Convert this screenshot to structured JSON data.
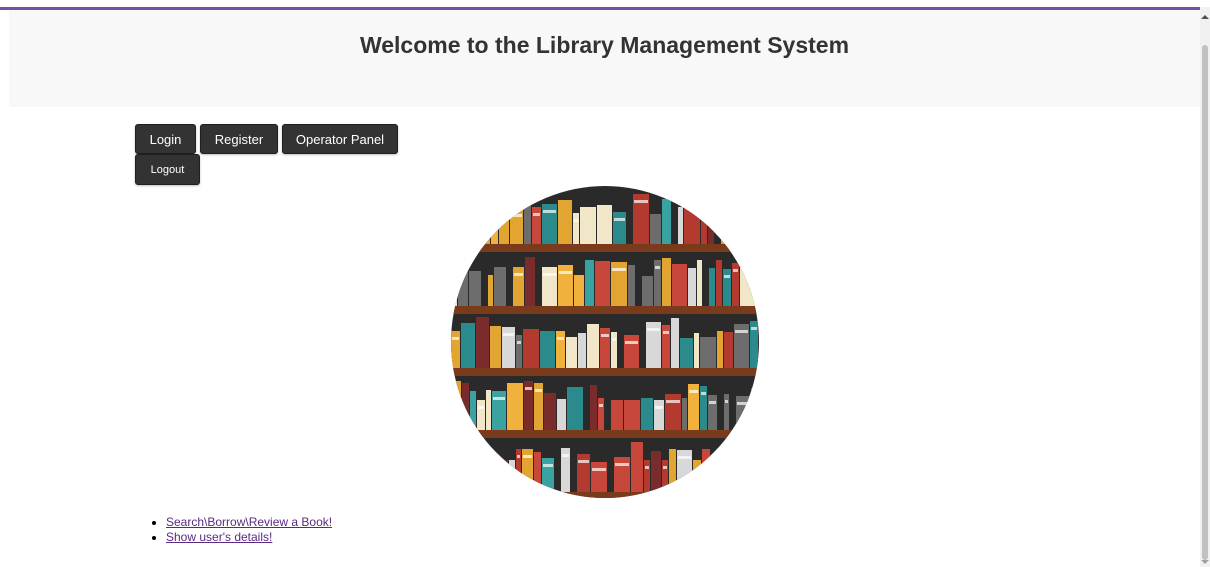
{
  "header": {
    "title": "Welcome to the Library Management System",
    "accent_color": "#7b4f9e"
  },
  "nav": {
    "login_label": "Login",
    "register_label": "Register",
    "operator_label": "Operator Panel",
    "logout_label": "Logout"
  },
  "hero": {
    "image_icon": "bookshelf-illustration"
  },
  "links": [
    {
      "label": "Search\\Borrow\\Review a Book!"
    },
    {
      "label": "Show user's details!"
    }
  ],
  "colors": {
    "button_bg": "#333333",
    "link": "#5a2a82"
  }
}
